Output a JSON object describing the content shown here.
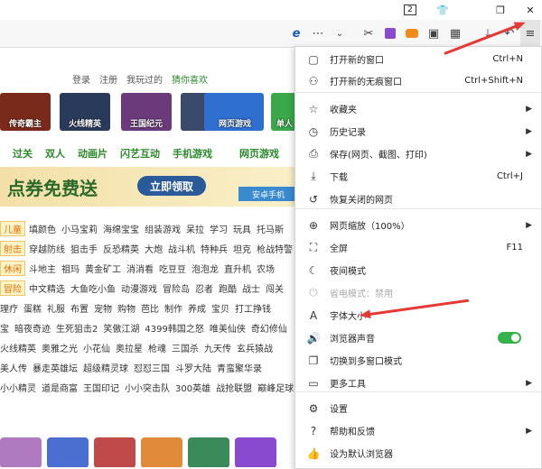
{
  "titlebar": {
    "tab_count": "2",
    "shirt_icon": "shirt-icon",
    "restore_icon": "restore-icon"
  },
  "toolbar": {
    "icons": [
      "ie-compat-icon",
      "more-dots-icon",
      "chevron-down-icon",
      "scissors-icon",
      "extension-icon",
      "game-icon",
      "screenshot-icon",
      "apps-grid-icon",
      "download-icon",
      "undo-icon",
      "menu-icon"
    ]
  },
  "site": {
    "login": [
      "登录",
      "注册",
      "我玩过的",
      "猜你喜欢"
    ],
    "games": [
      {
        "title": "传奇霸主",
        "color": "#7a2a1a"
      },
      {
        "title": "火线精英",
        "color": "#2a3a5a"
      },
      {
        "title": "王国纪元",
        "color": "#6a3a7a"
      },
      {
        "title": "",
        "color": "#3a4a6a"
      },
      {
        "title": "网页游戏",
        "color": "#2f6fcf"
      },
      {
        "title": "单人",
        "color": "#3aa84a"
      }
    ],
    "nav": [
      "过关",
      "双人",
      "动画片",
      "闪艺互动",
      "手机游戏",
      "网页游戏"
    ],
    "banner_text": "点券免费送",
    "banner_button": "立即领取",
    "banner_right": "安卓手机",
    "rows": [
      {
        "tag": "儿童",
        "items": [
          "填颜色",
          "小马宝莉",
          "海绵宝宝",
          "组装游戏",
          "呆拉",
          "学习",
          "玩具",
          "托马斯"
        ]
      },
      {
        "tag": "射击",
        "items": [
          "穿越防线",
          "狙击手",
          "反恐精英",
          "大炮",
          "战斗机",
          "特种兵",
          "坦克",
          "枪战特警"
        ]
      },
      {
        "tag": "休闲",
        "items": [
          "斗地主",
          "祖玛",
          "黄金矿工",
          "消消看",
          "吃豆豆",
          "泡泡龙",
          "直升机",
          "农场"
        ]
      },
      {
        "tag": "冒险",
        "items": [
          "中文精选",
          "大鱼吃小鱼",
          "动漫游戏",
          "冒险岛",
          "忍者",
          "跑酷",
          "战士",
          "闯关"
        ]
      },
      {
        "tag": "",
        "items": [
          "理疗",
          "蛋糕",
          "礼服",
          "布置",
          "宠物",
          "购物",
          "芭比",
          "制作",
          "养成",
          "宝贝",
          "打工挣钱"
        ]
      },
      {
        "tag": "",
        "items": [
          "宝",
          "暗夜奇迹",
          "生死狙击2",
          "笑傲江湖",
          "4399韩国之怒",
          "唯美仙侠",
          "奇幻修仙"
        ]
      },
      {
        "tag": "",
        "items": [
          "火线精英",
          "奥雅之光",
          "小花仙",
          "奥拉星",
          "枪魂",
          "三国杀",
          "九天传",
          "玄兵猿战"
        ]
      },
      {
        "tag": "",
        "items": [
          "美人传",
          "暴走英雄坛",
          "超级精灵球",
          "怼怼三国",
          "斗罗大陆",
          "青蛮聚华录"
        ]
      },
      {
        "tag": "",
        "items": [
          "小小精灵",
          "道是商富",
          "王国印记",
          "小小突击队",
          "300英雄",
          "战抢联盟",
          "巅峰足球"
        ]
      }
    ],
    "bottom_colors": [
      "#b07ac0",
      "#4a6fd0",
      "#c04a4a",
      "#e08a3a",
      "#3a8a5a",
      "#8a4ad0",
      "#d04a8a"
    ]
  },
  "menu": {
    "items": [
      {
        "icon": "new-window-icon",
        "label": "打开新的窗口",
        "shortcut": "Ctrl+N",
        "arrow": false
      },
      {
        "icon": "incognito-icon",
        "label": "打开新的无痕窗口",
        "shortcut": "Ctrl+Shift+N",
        "arrow": false
      },
      {
        "icon": "star-icon",
        "label": "收藏夹",
        "shortcut": "",
        "arrow": true
      },
      {
        "icon": "history-icon",
        "label": "历史记录",
        "shortcut": "",
        "arrow": true
      },
      {
        "icon": "save-icon",
        "label": "保存(网页、截图、打印)",
        "shortcut": "",
        "arrow": true
      },
      {
        "icon": "download-icon",
        "label": "下载",
        "shortcut": "Ctrl+J",
        "arrow": false
      },
      {
        "icon": "restore-page-icon",
        "label": "恢复关闭的网页",
        "shortcut": "",
        "arrow": false
      },
      {
        "icon": "zoom-icon",
        "label": "网页缩放（100%）",
        "shortcut": "",
        "arrow": true
      },
      {
        "icon": "fullscreen-icon",
        "label": "全屏",
        "shortcut": "F11",
        "arrow": false
      },
      {
        "icon": "night-mode-icon",
        "label": "夜间模式",
        "shortcut": "",
        "arrow": false
      },
      {
        "icon": "power-save-icon",
        "label": "省电模式：禁用",
        "shortcut": "",
        "arrow": false,
        "disabled": true
      },
      {
        "icon": "font-size-icon",
        "label": "字体大小",
        "shortcut": "",
        "arrow": false
      },
      {
        "icon": "speaker-icon",
        "label": "浏览器声音",
        "shortcut": "",
        "arrow": false,
        "toggle": true
      },
      {
        "icon": "multi-window-icon",
        "label": "切换到多窗口模式",
        "shortcut": "",
        "arrow": false
      },
      {
        "icon": "more-tools-icon",
        "label": "更多工具",
        "shortcut": "",
        "arrow": true
      },
      {
        "icon": "settings-icon",
        "label": "设置",
        "shortcut": "",
        "arrow": false
      },
      {
        "icon": "help-icon",
        "label": "帮助和反馈",
        "shortcut": "",
        "arrow": true
      },
      {
        "icon": "thumbs-up-icon",
        "label": "设为默认浏览器",
        "shortcut": "",
        "arrow": false
      }
    ],
    "sound_on": true
  },
  "colors": {
    "accent_red": "#e53935",
    "toggle_green": "#35b24a",
    "site_green": "#2a8a2a"
  }
}
